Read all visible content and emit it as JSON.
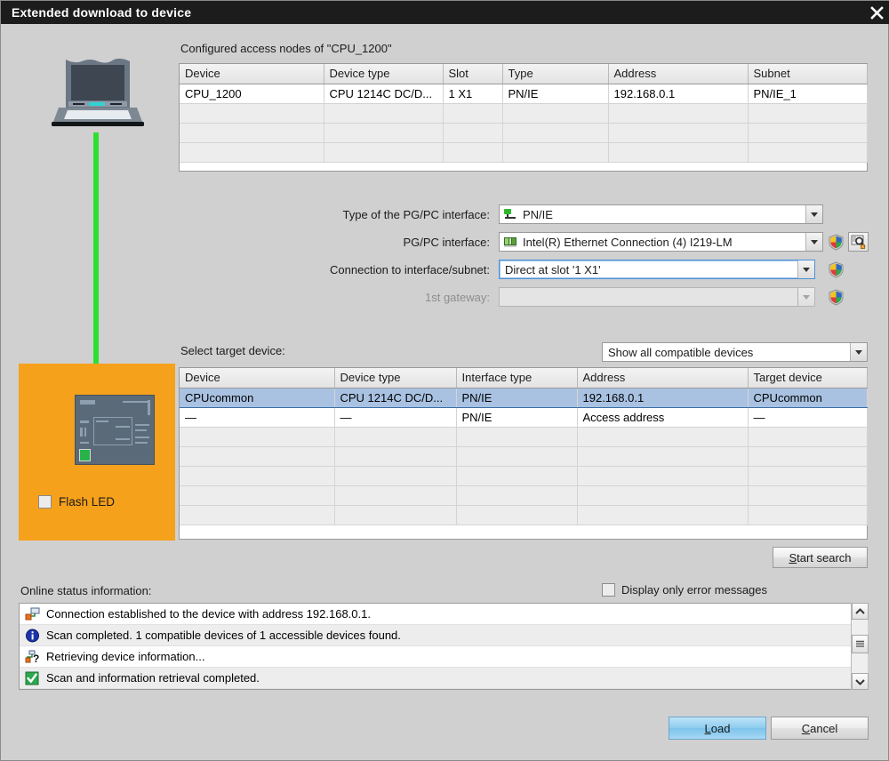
{
  "window": {
    "title": "Extended download to device",
    "close_icon": "close-icon"
  },
  "left_panel": {
    "laptop_icon": "laptop-icon",
    "cable_icon": "network-cable",
    "plc_icon": "plc-device-icon",
    "flash_led_label": "Flash LED",
    "flash_led_checked": false,
    "panel_color": "#f6a11b",
    "cable_color": "#2ee02e"
  },
  "configured_nodes": {
    "caption": "Configured access nodes of \"CPU_1200\"",
    "columns": [
      "Device",
      "Device type",
      "Slot",
      "Type",
      "Address",
      "Subnet"
    ],
    "rows": [
      [
        "CPU_1200",
        "CPU 1214C DC/D...",
        "1 X1",
        "PN/IE",
        "192.168.0.1",
        "PN/IE_1"
      ]
    ],
    "empty_rows": 4
  },
  "interface_form": {
    "rows": [
      {
        "label": "Type of the PG/PC interface:",
        "value": "PN/IE",
        "icon": "pnie-interface-icon",
        "disabled": false,
        "focused": false,
        "has_globe": false,
        "has_browse": false
      },
      {
        "label": "PG/PC interface:",
        "value": "Intel(R) Ethernet Connection (4) I219-LM",
        "icon": "network-card-icon",
        "disabled": false,
        "focused": false,
        "has_globe": true,
        "has_browse": true
      },
      {
        "label": "Connection to interface/subnet:",
        "value": "Direct at slot '1 X1'",
        "icon": "",
        "disabled": false,
        "focused": true,
        "has_globe": true,
        "has_browse": false
      },
      {
        "label": "1st gateway:",
        "value": "",
        "icon": "",
        "disabled": true,
        "focused": false,
        "has_globe": true,
        "has_browse": false
      }
    ],
    "globe_icon": "globe-properties-icon",
    "browse_icon": "search-network-icon"
  },
  "target_devices": {
    "caption": "Select target device:",
    "filter_value": "Show all compatible devices",
    "columns": [
      "Device",
      "Device type",
      "Interface type",
      "Address",
      "Target device"
    ],
    "rows": [
      {
        "cells": [
          "CPUcommon",
          "CPU 1214C DC/D...",
          "PN/IE",
          "192.168.0.1",
          "CPUcommon"
        ],
        "selected": true
      },
      {
        "cells": [
          "—",
          "—",
          "PN/IE",
          "Access address",
          "—"
        ],
        "selected": false
      }
    ],
    "empty_rows": 6
  },
  "start_search_button": {
    "prefix": "S",
    "rest": "tart search"
  },
  "status": {
    "caption": "Online status information:",
    "error_filter_label": "Display only error messages",
    "error_filter_checked": false,
    "messages": [
      {
        "icon": "connection-established-icon",
        "text": "Connection established to the device with address 192.168.0.1."
      },
      {
        "icon": "info-icon",
        "text": "Scan completed. 1 compatible devices of 1 accessible devices found."
      },
      {
        "icon": "retrieving-info-icon",
        "text": "Retrieving device information..."
      },
      {
        "icon": "success-check-icon",
        "text": "Scan and information retrieval completed."
      }
    ],
    "scroll_up_icon": "scroll-up-arrow",
    "scroll_down_icon": "scroll-down-arrow",
    "scroll_thumb_icon": "scrollbar-thumb"
  },
  "footer": {
    "load_prefix": "L",
    "load_rest": "oad",
    "cancel_prefix": "C",
    "cancel_rest": "ancel"
  },
  "colors": {
    "titlebar": "#1c1c1c",
    "dialog_bg": "#d0d0d0",
    "selection": "#a9c2e2",
    "accent_blue": "#4a90d9",
    "orange": "#f6a11b",
    "green": "#2ee02e"
  }
}
